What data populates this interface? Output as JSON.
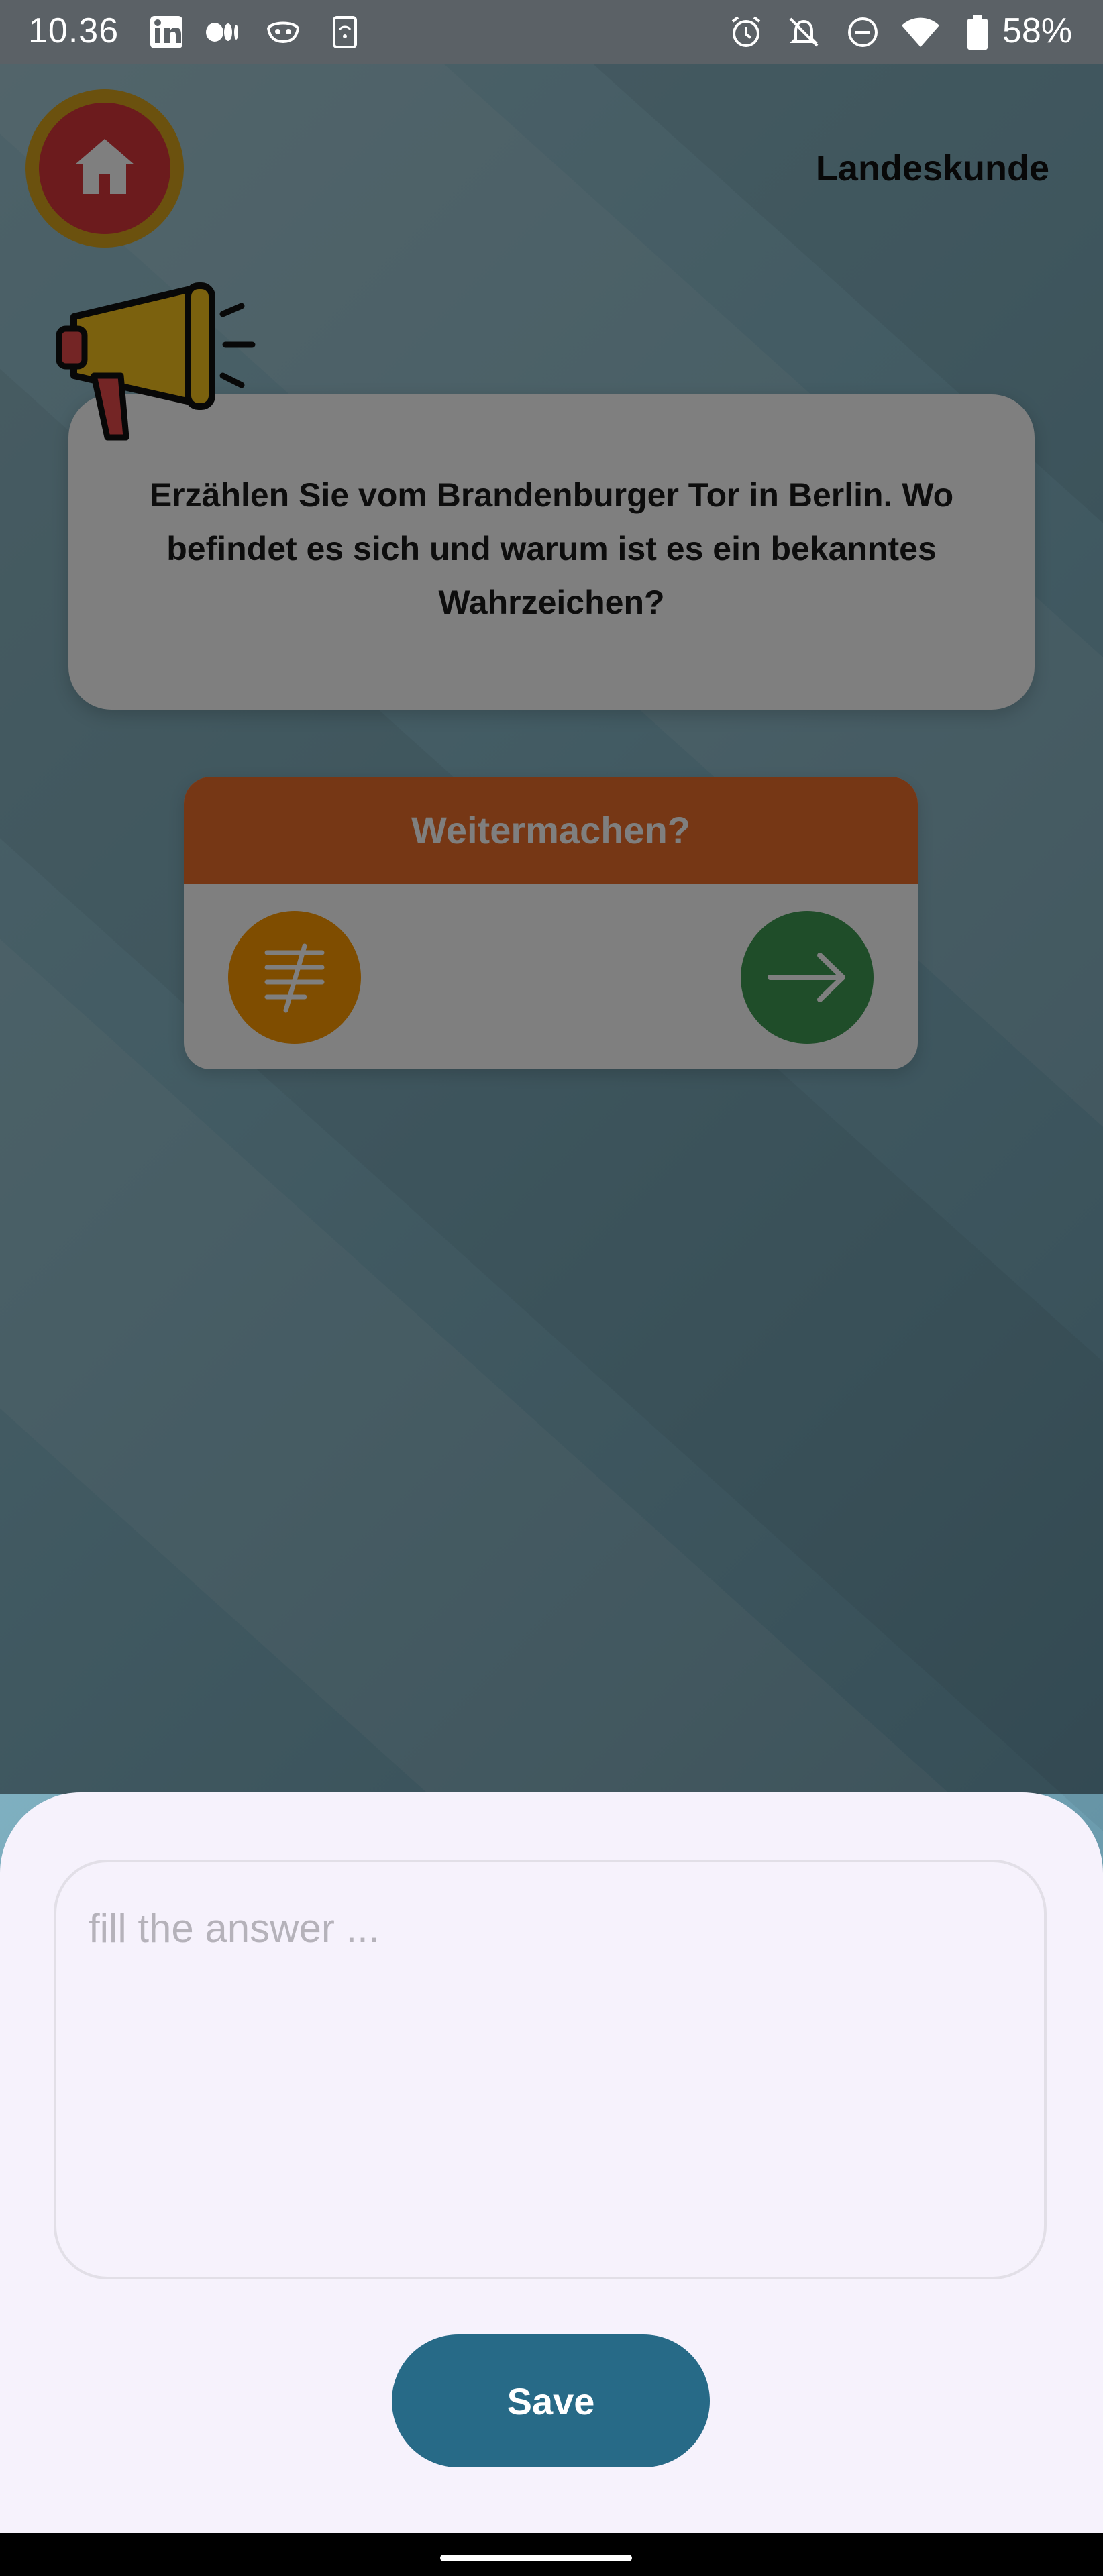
{
  "status_bar": {
    "time": "10.36",
    "battery_percent": "58%",
    "left_icons": [
      "linkedin-icon",
      "medium-icon",
      "mask-icon",
      "sim-icon"
    ],
    "right_icons": [
      "alarm-icon",
      "notifications-off-icon",
      "do-not-disturb-icon",
      "wifi-4g-icon",
      "battery-icon"
    ]
  },
  "header": {
    "title": "Landeskunde",
    "home_icon": "home-icon"
  },
  "question": {
    "icon": "megaphone-icon",
    "text": "Erzählen Sie vom Brandenburger Tor in Berlin. Wo befindet es sich und warum ist es ein bekanntes Wahrzeichen?"
  },
  "continue_card": {
    "title": "Weitermachen?",
    "left_icon": "notes-icon",
    "right_icon": "arrow-right-icon"
  },
  "bottom_sheet": {
    "answer_placeholder": "fill the answer ...",
    "answer_value": "",
    "save_label": "Save"
  },
  "colors": {
    "status_bar": "#5b6166",
    "home_outer": "#d6a21d",
    "home_inner": "#d9363b",
    "continue_header": "#ed6e2a",
    "notes_button": "#ff9a00",
    "next_button": "#3f9a52",
    "save_button": "#276a87",
    "sheet_background": "#f6f2fc"
  }
}
